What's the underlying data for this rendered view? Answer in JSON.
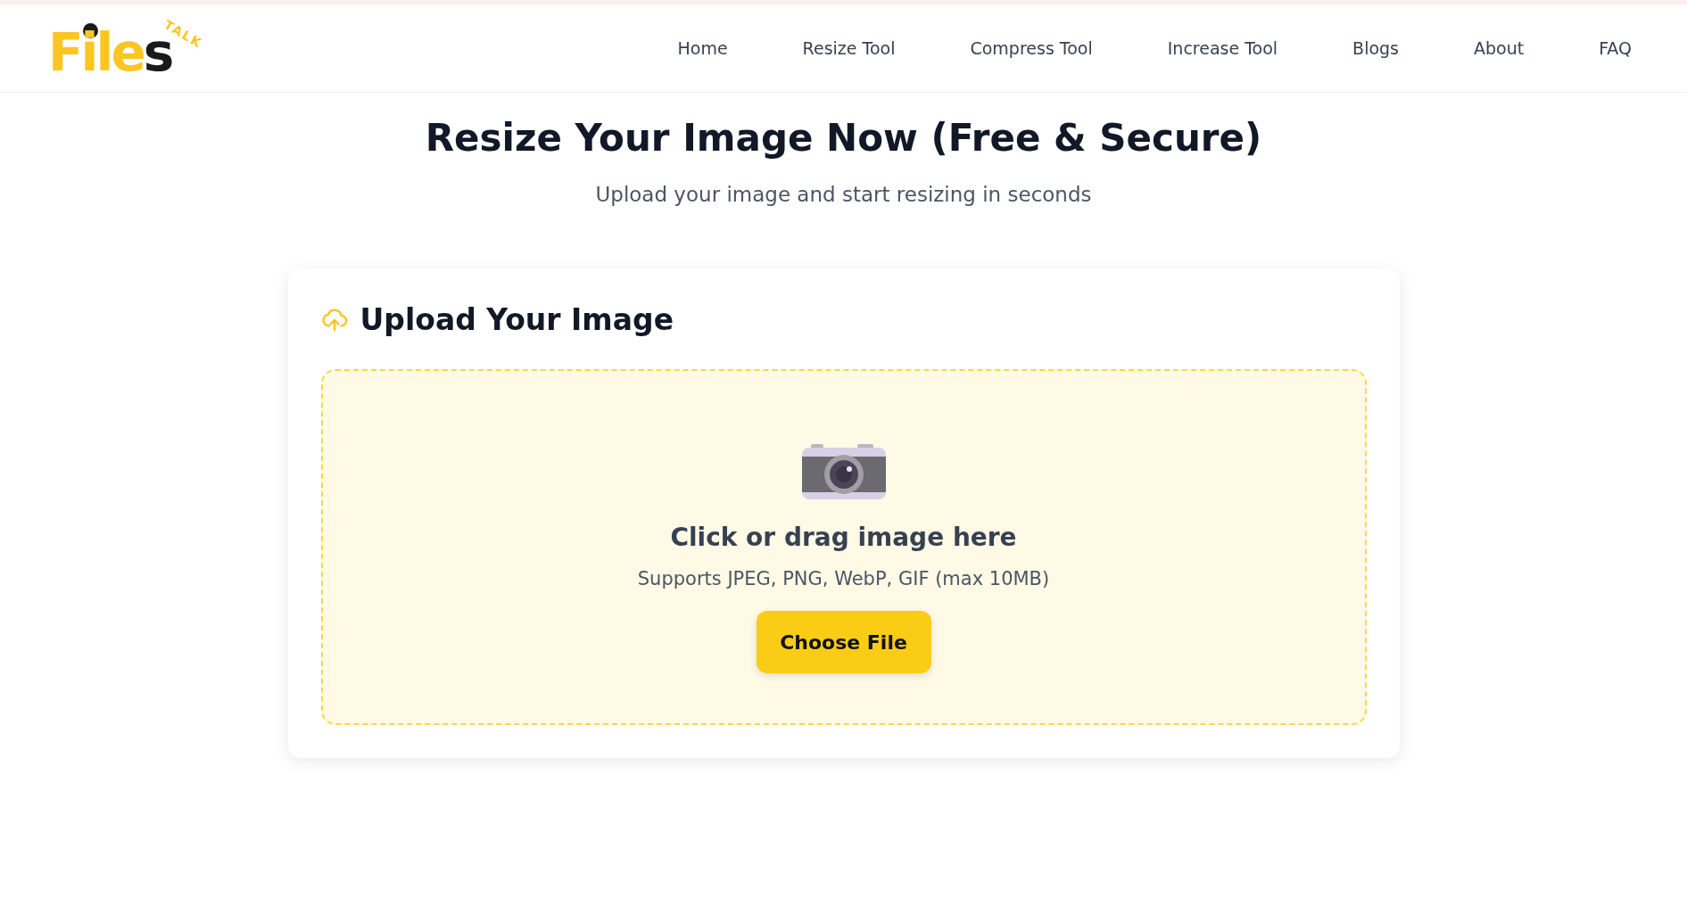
{
  "logo": {
    "word": "File**s**",
    "tag": "TALK"
  },
  "nav": [
    {
      "label": "Home"
    },
    {
      "label": "Resize Tool"
    },
    {
      "label": "Compress Tool"
    },
    {
      "label": "Increase Tool"
    },
    {
      "label": "Blogs"
    },
    {
      "label": "About"
    },
    {
      "label": "FAQ"
    }
  ],
  "hero": {
    "title": "Resize Your Image Now (Free & Secure)",
    "subtitle": "Upload your image and start resizing in seconds"
  },
  "upload_card": {
    "heading": "Upload Your Image",
    "dropzone": {
      "prompt": "Click or drag image here",
      "hint": "Supports JPEG, PNG, WebP, GIF (max 10MB)",
      "button": "Choose File"
    }
  }
}
